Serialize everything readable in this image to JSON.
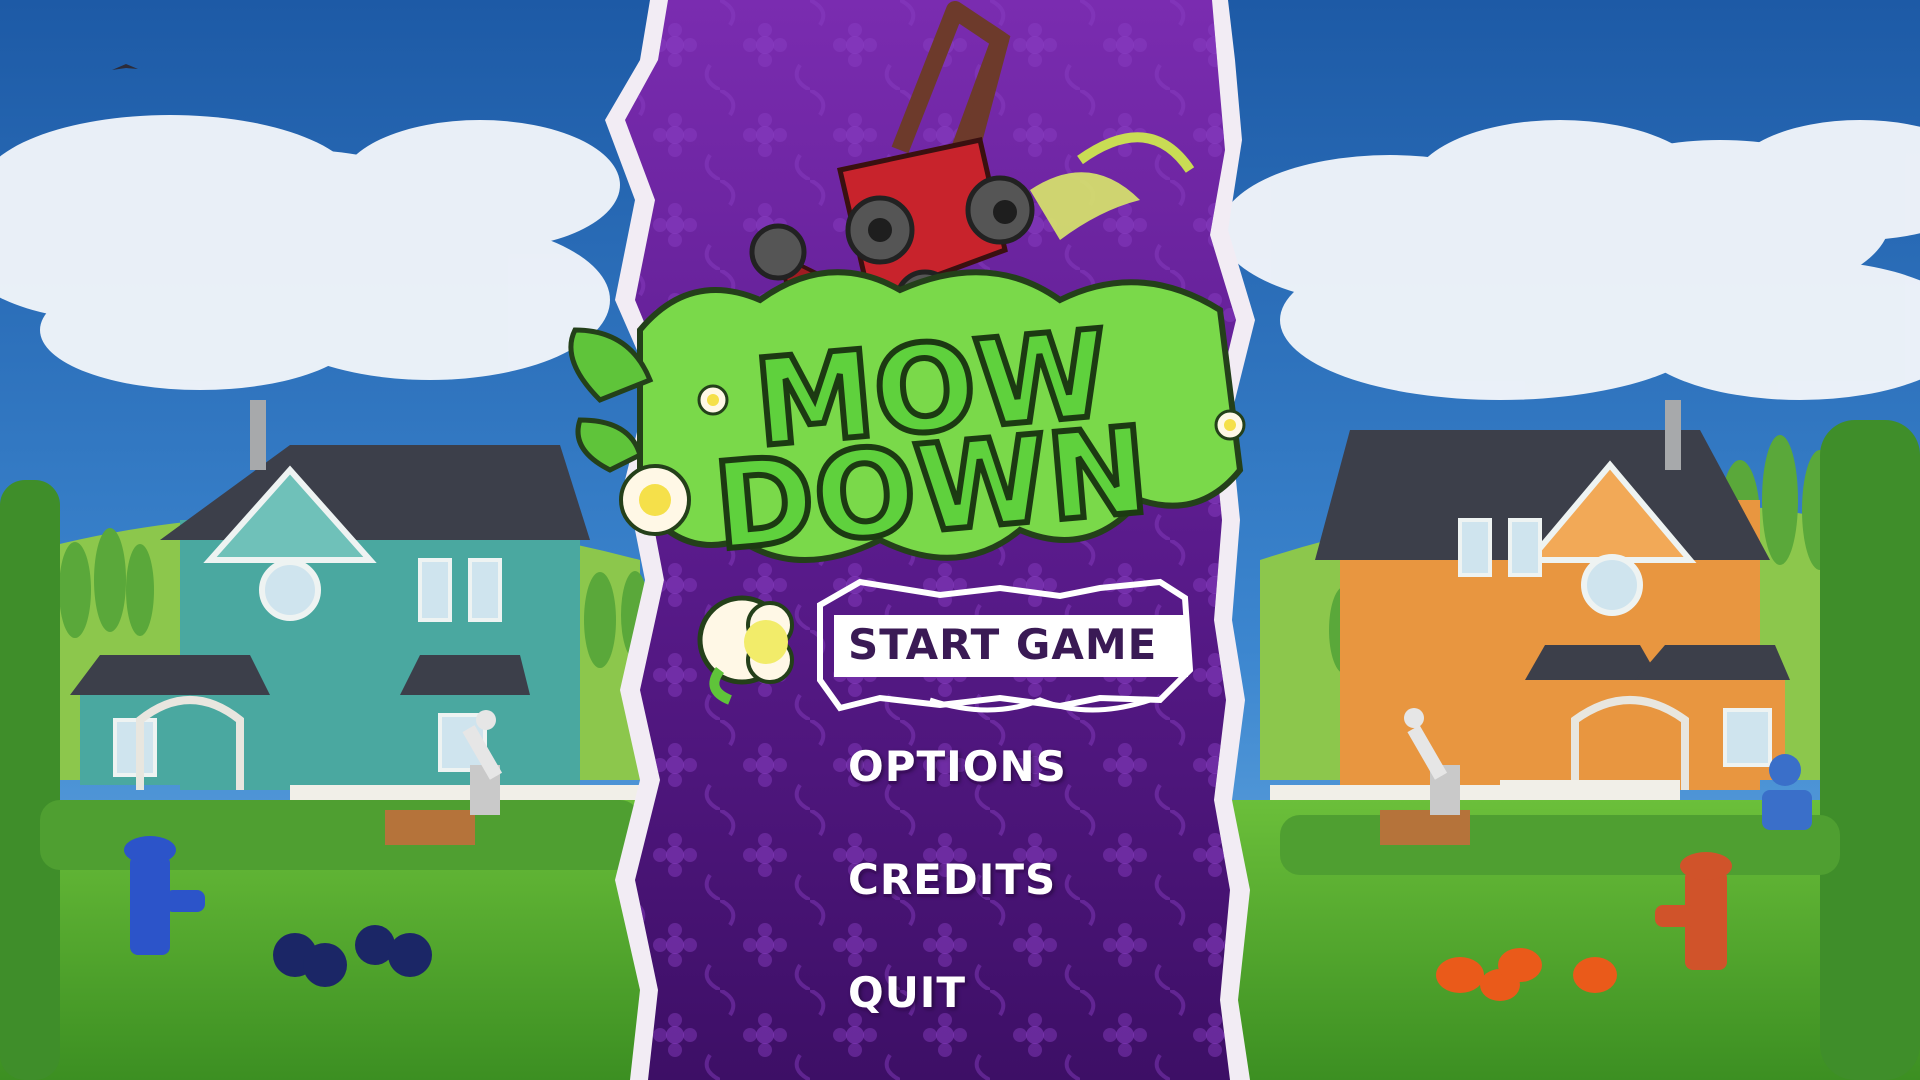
{
  "game": {
    "title_line1": "MOW",
    "title_line2": "DOWN"
  },
  "menu": {
    "items": [
      {
        "label": "START GAME",
        "selected": true
      },
      {
        "label": "OPTIONS",
        "selected": false
      },
      {
        "label": "CREDITS",
        "selected": false
      },
      {
        "label": "QUIT",
        "selected": false
      }
    ]
  },
  "colors": {
    "panel_purple": "#5e1c8e",
    "panel_dark": "#3f0f66",
    "grass_logo": "#5fd13d",
    "mower_red": "#c8232c",
    "sky": "#2d6fb7",
    "highlight_box": "#ffffff"
  }
}
